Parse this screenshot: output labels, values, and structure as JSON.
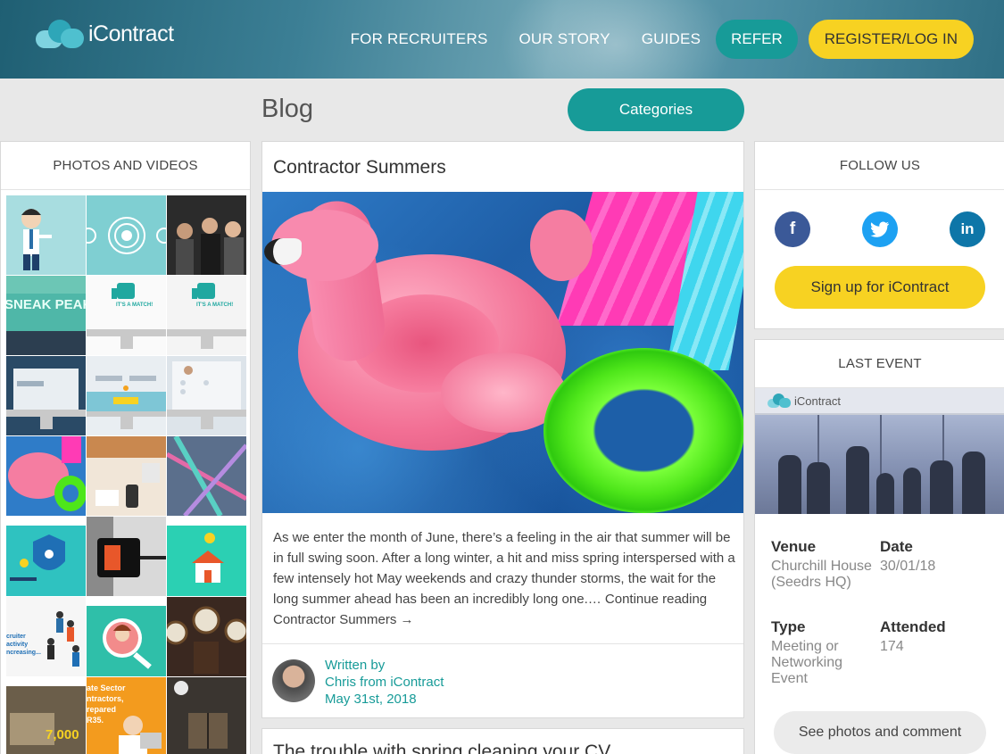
{
  "header": {
    "logo_text": "iContract",
    "nav": [
      "FOR RECRUITERS",
      "OUR STORY",
      "GUIDES"
    ],
    "refer_label": "REFER",
    "register_label": "REGISTER/LOG IN"
  },
  "blog": {
    "title": "Blog",
    "categories_label": "Categories"
  },
  "photos": {
    "heading": "PHOTOS AND VIDEOS",
    "tile_texts": [
      "SNEAK PEAK",
      "IT'S A MATCH!",
      "IT'S A MATCH!",
      "cruiter activity ncreasing...",
      "ate Sector ntractors, repared R35.",
      "7,000"
    ]
  },
  "article": {
    "title": "Contractor Summers",
    "excerpt": "As we enter the month of June, there’s a feeling in the air that summer will be in full swing soon. After a long winter, a hit and miss spring interspersed with a few intensely hot May weekends and crazy thunder storms, the wait for the long summer ahead has been an incredibly long one.… Continue reading Contractor Summers →",
    "written_by": "Written by",
    "author": "Chris from iContract",
    "date": "May 31st, 2018"
  },
  "article2": {
    "title": "The trouble with spring cleaning your CV"
  },
  "follow": {
    "heading": "FOLLOW US",
    "facebook": "f",
    "twitter": "t",
    "linkedin": "in",
    "signup_label": "Sign up for iContract"
  },
  "event": {
    "heading": "LAST EVENT",
    "image_logo_text": "iContract",
    "venue_label": "Venue",
    "venue": "Churchill House (Seedrs HQ)",
    "date_label": "Date",
    "date": "30/01/18",
    "type_label": "Type",
    "type": "Meeting or Networking Event",
    "attended_label": "Attended",
    "attended": "174",
    "see_photos_label": "See photos and comment"
  },
  "colors": {
    "teal": "#179b98",
    "yellow": "#f7d222",
    "background": "#e8e8e8"
  }
}
